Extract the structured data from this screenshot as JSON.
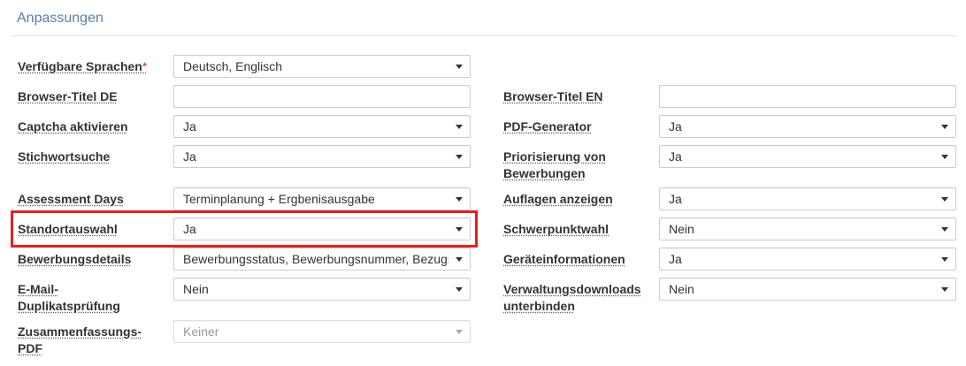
{
  "section": {
    "title": "Anpassungen"
  },
  "fields": {
    "verfuegbare_sprachen": {
      "label": "Verfügbare Sprachen",
      "required_mark": "*",
      "value": "Deutsch, Englisch"
    },
    "browser_titel_de": {
      "label": "Browser-Titel DE",
      "value": ""
    },
    "browser_titel_en": {
      "label": "Browser-Titel EN",
      "value": ""
    },
    "captcha": {
      "label": "Captcha aktivieren",
      "value": "Ja"
    },
    "pdf_generator": {
      "label": "PDF-Generator",
      "value": "Ja"
    },
    "stichwortsuche": {
      "label": "Stichwortsuche",
      "value": "Ja"
    },
    "priorisierung": {
      "label_line1": "Priorisierung von",
      "label_line2": "Bewerbungen",
      "value": "Ja"
    },
    "assessment_days": {
      "label": "Assessment Days",
      "value": "Terminplanung + Ergbenisausgabe"
    },
    "auflagen": {
      "label": "Auflagen anzeigen",
      "value": "Ja"
    },
    "standortauswahl": {
      "label": "Standortauswahl",
      "value": "Ja"
    },
    "schwerpunktwahl": {
      "label": "Schwerpunktwahl",
      "value": "Nein"
    },
    "bewerbungsdetails": {
      "label": "Bewerbungsdetails",
      "value": "Bewerbungsstatus, Bewerbungsnummer, Bezugsse"
    },
    "geraeteinformationen": {
      "label": "Geräteinformationen",
      "value": "Ja"
    },
    "email_duplikat": {
      "label_line1": "E-Mail-",
      "label_line2": "Duplikatsprüfung",
      "value": "Nein"
    },
    "verwaltungsdownloads": {
      "label_line1": "Verwaltungsdownloads",
      "label_line2": "unterbinden",
      "value": "Nein"
    },
    "zusammenfassung_pdf": {
      "label_line1": "Zusammenfassungs-",
      "label_line2": "PDF",
      "value": "Keiner",
      "disabled": true
    }
  },
  "colors": {
    "title": "#5b7fa8",
    "highlight": "#e02020",
    "required": "#c9302c"
  },
  "icons": {
    "dropdown": "chevron-down-icon"
  }
}
